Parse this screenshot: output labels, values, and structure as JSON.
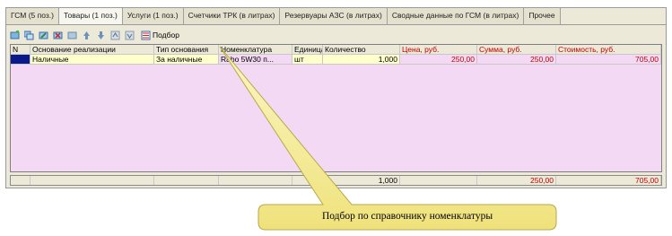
{
  "tabs": [
    "ГСМ (5 поз.)",
    "Товары (1 поз.)",
    "Услуги (1 поз.)",
    "Счетчики ТРК (в литрах)",
    "Резервуары АЗС (в литрах)",
    "Сводные данные по ГСМ (в литрах)",
    "Прочее"
  ],
  "toolbar": {
    "select_label": "Подбор"
  },
  "columns": [
    "N",
    "Основание реализации",
    "Тип основания",
    "Номенклатура",
    "Единица",
    "Количество",
    "Цена, руб.",
    "Сумма, руб.",
    "Стоимость, руб."
  ],
  "rows": [
    {
      "n": "",
      "basis": "Наличные",
      "basis_type": "За наличные",
      "item": "Rabo 5W30 п...",
      "unit": "шт",
      "qty": "1,000",
      "price": "250,00",
      "sum": "250,00",
      "cost": "705,00"
    }
  ],
  "totals": {
    "qty": "1,000",
    "sum": "250,00",
    "cost": "705,00"
  },
  "callout": {
    "text": "Подбор по справочнику номенклатуры"
  },
  "colors": {
    "row_highlight": "#ffffcc",
    "row_pink": "#f4d9f4",
    "callout_fill": "#f7f0a0",
    "money_red": "#c00000"
  }
}
